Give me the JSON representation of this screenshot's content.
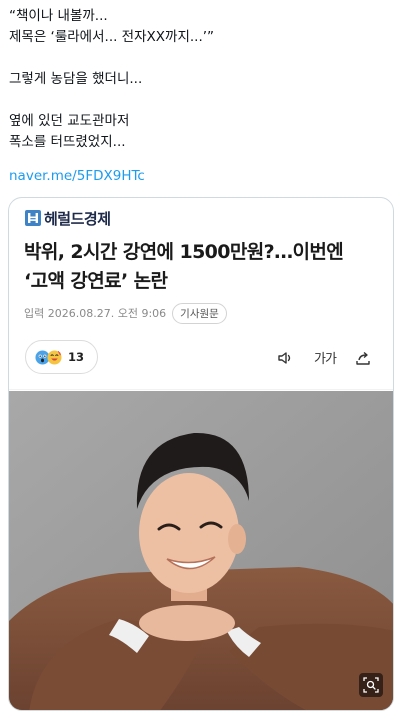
{
  "post": {
    "lines": [
      "“책이나 내볼까...",
      "제목은 ‘룰라에서... 전자XX까지...’”",
      "그렇게 농담을 했더니...",
      "옆에 있던 교도관마저",
      "폭소를 터뜨렸었지..."
    ],
    "link": "naver.me/5FDX9HTc"
  },
  "card": {
    "brand": "헤럴드경제",
    "headline_lines": [
      "박위, 2시간 강연에 1500만원?…이번엔",
      "‘고액 강연료’ 논란"
    ],
    "date": "입력 2026.08.27. 오전 9:06",
    "badge": "기사원문",
    "reaction_count": "13",
    "font_size_label": "가가"
  },
  "colors": {
    "link": "#1d9bf0",
    "brand_navy": "#1e2a4a",
    "brand_blue": "#3f83c6"
  },
  "icons": [
    "brand-logo-icon",
    "surprised-emoji-icon",
    "cheer-emoji-icon",
    "speaker-icon",
    "share-icon",
    "zoom-icon"
  ]
}
